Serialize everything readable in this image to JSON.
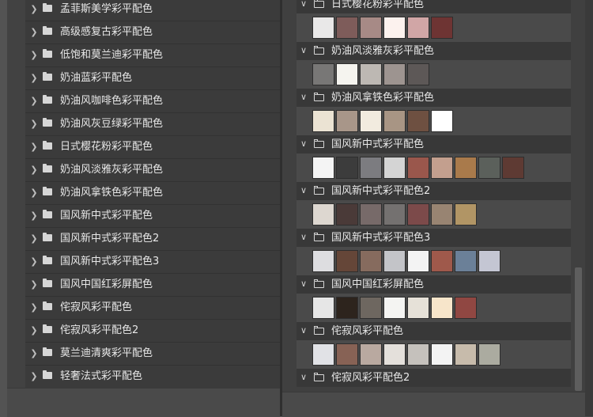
{
  "left_list": {
    "items": [
      {
        "label": "孟菲斯美学彩平配色"
      },
      {
        "label": "高级感复古彩平配色"
      },
      {
        "label": "低饱和莫兰迪彩平配色"
      },
      {
        "label": "奶油蓝彩平配色"
      },
      {
        "label": "奶油风咖啡色彩平配色"
      },
      {
        "label": "奶油风灰豆绿彩平配色"
      },
      {
        "label": "日式樱花粉彩平配色"
      },
      {
        "label": "奶油风淡雅灰彩平配色"
      },
      {
        "label": "奶油风拿铁色彩平配色"
      },
      {
        "label": "国风新中式彩平配色"
      },
      {
        "label": "国风新中式彩平配色2"
      },
      {
        "label": "国风新中式彩平配色3"
      },
      {
        "label": "国风中国红彩屏配色"
      },
      {
        "label": "侘寂风彩平配色"
      },
      {
        "label": "侘寂风彩平配色2"
      },
      {
        "label": "莫兰迪清爽彩平配色"
      },
      {
        "label": "轻奢法式彩平配色"
      }
    ]
  },
  "right_groups": [
    {
      "label": "日式樱花粉彩平配色",
      "swatches": [
        "#e9e8e8",
        "#7e5c5a",
        "#a78a86",
        "#fcf2ee",
        "#d1a6a6",
        "#6e3433"
      ]
    },
    {
      "label": "奶油风淡雅灰彩平配色",
      "swatches": [
        "#787776",
        "#f5f4ef",
        "#bdb8b3",
        "#9d9490",
        "#5d5857"
      ]
    },
    {
      "label": "奶油风拿铁色彩平配色",
      "swatches": [
        "#ebe3d3",
        "#a89689",
        "#f2ebdf",
        "#a89584",
        "#6e5041",
        "#ffffff"
      ]
    },
    {
      "label": "国风新中式彩平配色",
      "swatches": [
        "#f4f4f4",
        "#3c3c3c",
        "#7c7c80",
        "#d4d4d4",
        "#9a574c",
        "#c39f8e",
        "#a97a4b",
        "#5b605b",
        "#5e3a33"
      ]
    },
    {
      "label": "国风新中式彩平配色2",
      "swatches": [
        "#ddd7d0",
        "#4a3a38",
        "#776a69",
        "#747170",
        "#7c4a4a",
        "#988472",
        "#b19565"
      ]
    },
    {
      "label": "国风新中式彩平配色3",
      "swatches": [
        "#dddde0",
        "#654638",
        "#866b5e",
        "#c3c4c8",
        "#f3f3f3",
        "#9f594b",
        "#6b8098",
        "#c4c6d3"
      ]
    },
    {
      "label": "国风中国红彩屏配色",
      "swatches": [
        "#e6e6e6",
        "#2d241d",
        "#6e6760",
        "#f4f4f2",
        "#e6e1d8",
        "#f7e5ca",
        "#904742"
      ]
    },
    {
      "label": "侘寂风彩平配色",
      "swatches": [
        "#e1e2e6",
        "#876255",
        "#b9a9a0",
        "#e4e0db",
        "#c5c1bc",
        "#f3f3f3",
        "#c7bbab",
        "#ababa0"
      ]
    },
    {
      "label": "侘寂风彩平配色2",
      "swatches": []
    }
  ]
}
